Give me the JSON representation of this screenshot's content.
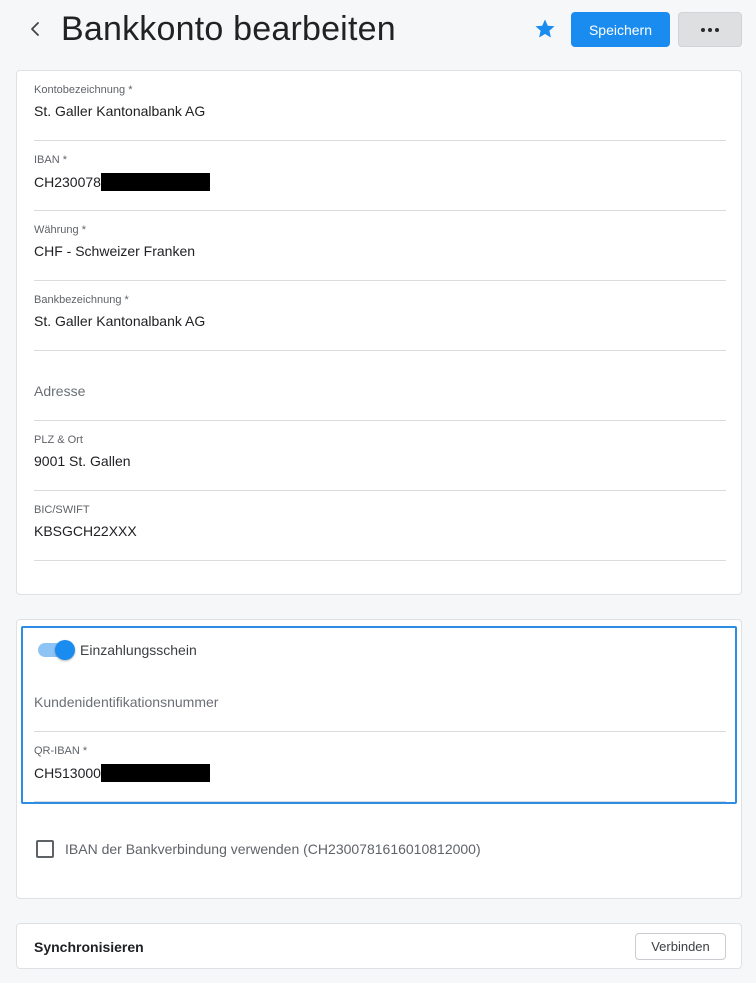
{
  "header": {
    "title": "Bankkonto bearbeiten",
    "save_label": "Speichern",
    "icons": {
      "back": "chevron-left-icon",
      "favorite": "star-icon",
      "more": "more-horizontal-icon"
    },
    "accent_color": "#1a8cf0"
  },
  "bank_form": {
    "account_name": {
      "label": "Kontobezeichnung *",
      "value": "St. Galler Kantonalbank AG"
    },
    "iban": {
      "label": "IBAN *",
      "value": "CH230078"
    },
    "currency": {
      "label": "Währung *",
      "value": "CHF - Schweizer Franken"
    },
    "bank_name": {
      "label": "Bankbezeichnung *",
      "value": "St. Galler Kantonalbank AG"
    },
    "address": {
      "placeholder": "Adresse"
    },
    "zip_city": {
      "label": "PLZ & Ort",
      "value": "9001 St. Gallen"
    },
    "bic": {
      "label": "BIC/SWIFT",
      "value": "KBSGCH22XXX"
    }
  },
  "payment_slip": {
    "toggle_label": "Einzahlungsschein",
    "toggle_on": true,
    "customer_id": {
      "placeholder": "Kundenidentifikationsnummer"
    },
    "qr_iban": {
      "label": "QR-IBAN *",
      "value": "CH513000"
    },
    "use_iban_checkbox": {
      "label": "IBAN der Bankverbindung verwenden (CH2300781616010812000)",
      "checked": false
    }
  },
  "sync": {
    "title": "Synchronisieren",
    "connect_label": "Verbinden"
  }
}
